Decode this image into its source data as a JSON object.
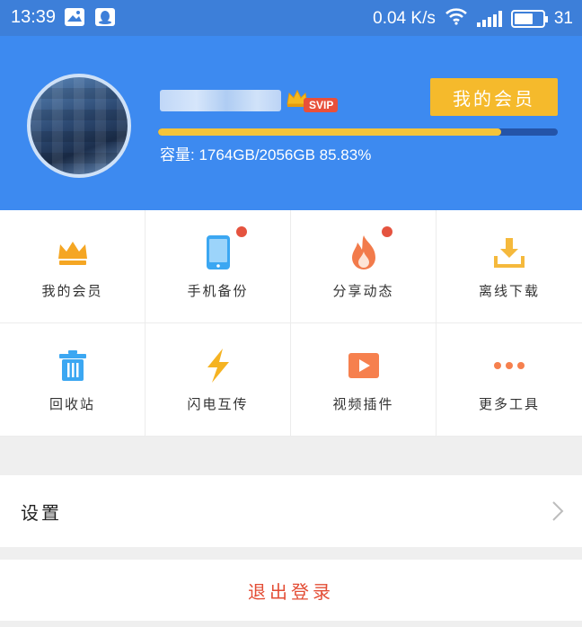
{
  "status_bar": {
    "time": "13:39",
    "network_speed": "0.04 K/s",
    "battery": "31",
    "battery_level": 0.7
  },
  "profile": {
    "badge": "SVIP",
    "vip_button": "我的会员",
    "capacity_text": "容量: 1764GB/2056GB 85.83%",
    "capacity_fraction": 0.8583
  },
  "tools": [
    {
      "label": "我的会员",
      "icon": "crown-icon",
      "color": "#f5a623",
      "has_dot": false
    },
    {
      "label": "手机备份",
      "icon": "phone-icon",
      "color": "#3ba7f2",
      "has_dot": true
    },
    {
      "label": "分享动态",
      "icon": "fire-icon",
      "color": "#f27b4b",
      "has_dot": true
    },
    {
      "label": "离线下载",
      "icon": "download-icon",
      "color": "#f5b93c",
      "has_dot": false
    },
    {
      "label": "回收站",
      "icon": "trash-icon",
      "color": "#3ba7f2",
      "has_dot": false
    },
    {
      "label": "闪电互传",
      "icon": "lightning-icon",
      "color": "#f5b322",
      "has_dot": false
    },
    {
      "label": "视频插件",
      "icon": "video-icon",
      "color": "#f6804e",
      "has_dot": false
    },
    {
      "label": "更多工具",
      "icon": "more-icon",
      "color": "#f6804e",
      "has_dot": false
    }
  ],
  "settings": {
    "label": "设置"
  },
  "logout": {
    "label": "退出登录"
  },
  "colors": {
    "accent": "#3d8af0",
    "vip_gold": "#f5ba2c",
    "badge_red": "#e5533f",
    "logout_red": "#e34d35"
  }
}
